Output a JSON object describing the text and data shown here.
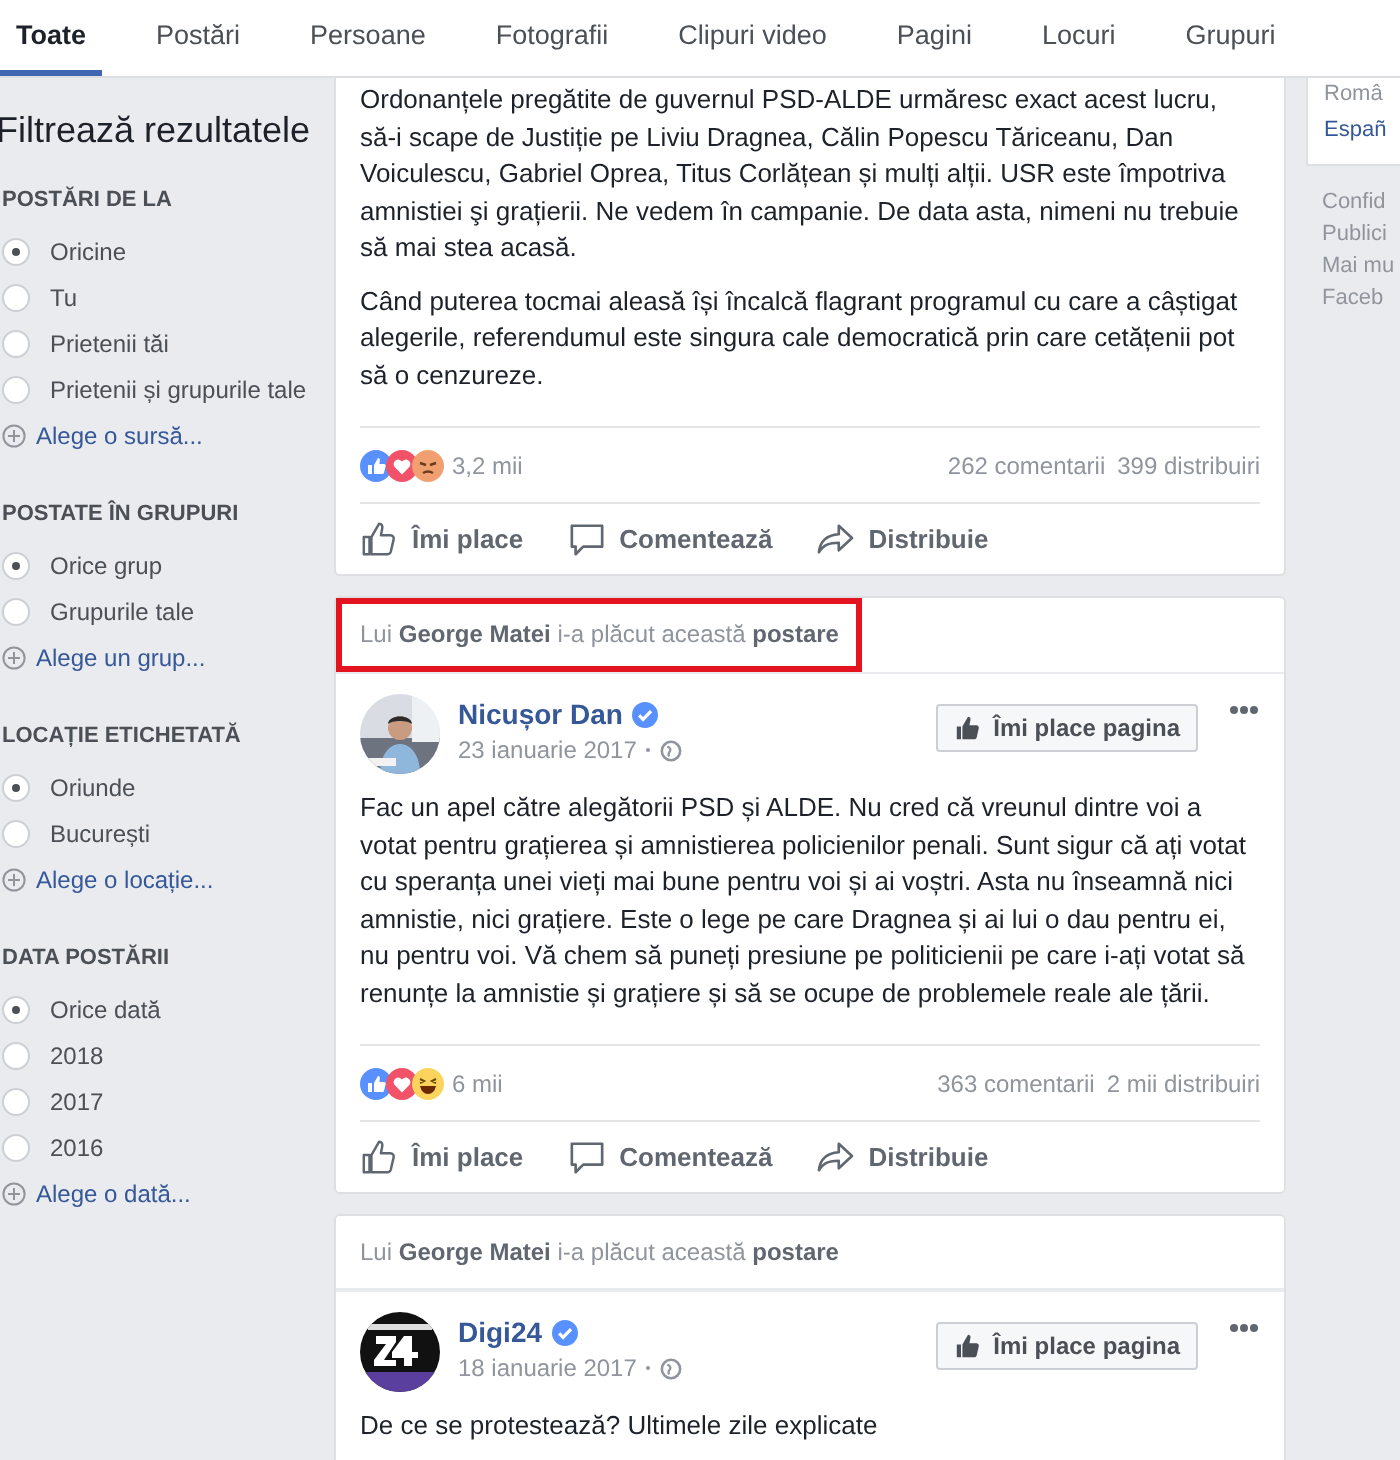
{
  "tabs": [
    {
      "label": "Toate",
      "selected": true
    },
    {
      "label": "Postări",
      "selected": false
    },
    {
      "label": "Persoane",
      "selected": false
    },
    {
      "label": "Fotografii",
      "selected": false
    },
    {
      "label": "Clipuri video",
      "selected": false
    },
    {
      "label": "Pagini",
      "selected": false
    },
    {
      "label": "Locuri",
      "selected": false
    },
    {
      "label": "Grupuri",
      "selected": false
    }
  ],
  "sidebar": {
    "title": "Filtrează rezultatele",
    "sections": [
      {
        "title": "POSTĂRI DE LA",
        "options": [
          {
            "label": "Oricine",
            "selected": true
          },
          {
            "label": "Tu",
            "selected": false
          },
          {
            "label": "Prietenii tăi",
            "selected": false
          },
          {
            "label": "Prietenii și grupurile tale",
            "selected": false
          }
        ],
        "link": "Alege o sursă..."
      },
      {
        "title": "POSTATE ÎN GRUPURI",
        "options": [
          {
            "label": "Orice grup",
            "selected": true
          },
          {
            "label": "Grupurile tale",
            "selected": false
          }
        ],
        "link": "Alege un grup..."
      },
      {
        "title": "LOCAȚIE ETICHETATĂ",
        "options": [
          {
            "label": "Oriunde",
            "selected": true
          },
          {
            "label": "București",
            "selected": false
          }
        ],
        "link": "Alege o locație..."
      },
      {
        "title": "DATA POSTĂRII",
        "options": [
          {
            "label": "Orice dată",
            "selected": true
          },
          {
            "label": "2018",
            "selected": false
          },
          {
            "label": "2017",
            "selected": false
          },
          {
            "label": "2016",
            "selected": false
          }
        ],
        "link": "Alege o dată..."
      }
    ]
  },
  "posts": [
    {
      "paragraphs": [
        "Ordonanțele pregătite de guvernul PSD-ALDE urmăresc exact acest lucru, să-i scape de Justiție pe Liviu Dragnea, Călin Popescu Tăriceanu, Dan Voiculescu, Gabriel Oprea, Titus Corlățean și mulți alții. USR este împotriva amnistiei şi grațierii. Ne vedem în campanie. De data asta, nimeni nu trebuie să mai stea acasă.",
        "Când puterea tocmai aleasă își încalcă flagrant programul cu care a câștigat alegerile, referendumul este singura cale democratică prin care cetățenii pot să o cenzureze."
      ],
      "reactions": [
        {
          "kind": "like"
        },
        {
          "kind": "love"
        },
        {
          "kind": "angry"
        }
      ],
      "reaction_count": "3,2 mii",
      "comments": "262 comentarii",
      "shares": "399 distribuiri",
      "actions": [
        {
          "kind": "like",
          "label": "Îmi place"
        },
        {
          "kind": "comment",
          "label": "Comentează"
        },
        {
          "kind": "share",
          "label": "Distribuie"
        }
      ]
    },
    {
      "liked_by": "Lui **George Matei** i-a plăcut această **postare**",
      "highlighted": true,
      "author": {
        "name": "Nicușor Dan",
        "verified": true,
        "date": "23 ianuarie 2017",
        "like_page": "Îmi place pagina"
      },
      "paragraphs": [
        "Fac un apel către alegătorii PSD și ALDE. Nu cred că vreunul dintre voi a votat pentru grațierea și amnistierea policienilor penali. Sunt sigur că ați votat cu speranța unei vieți mai bune pentru voi și ai voștri. Asta nu înseamnă nici amnistie, nici grațiere. Este o lege pe care Dragnea și ai lui o dau pentru ei, nu pentru voi. Vă chem să puneți presiune pe politicienii pe care i-ați votat să renunțe la amnistie și grațiere și să se ocupe de problemele reale ale țării."
      ],
      "reactions": [
        {
          "kind": "like"
        },
        {
          "kind": "love"
        },
        {
          "kind": "haha"
        }
      ],
      "reaction_count": "6 mii",
      "comments": "363 comentarii",
      "shares": "2 mii distribuiri",
      "actions": [
        {
          "kind": "like",
          "label": "Îmi place"
        },
        {
          "kind": "comment",
          "label": "Comentează"
        },
        {
          "kind": "share",
          "label": "Distribuie"
        }
      ]
    },
    {
      "liked_by": "Lui **George Matei** i-a plăcut această **postare**",
      "highlighted": false,
      "author": {
        "name": "Digi24",
        "verified": true,
        "date": "18 ianuarie 2017",
        "like_page": "Îmi place pagina"
      },
      "paragraphs": [
        "De ce se protestează? Ultimele zile explicate"
      ]
    }
  ],
  "right_column": {
    "languages": [
      "Româ",
      "Españ"
    ],
    "links": [
      "Confid",
      "Publici",
      "Mai mu",
      "Faceb"
    ]
  }
}
